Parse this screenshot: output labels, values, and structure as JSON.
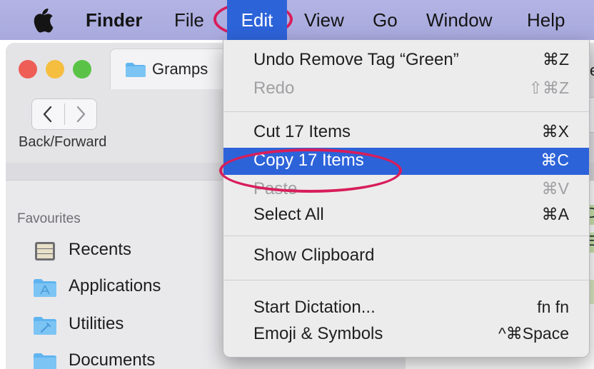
{
  "menubar": {
    "apple_icon": "apple-logo-icon",
    "items": [
      "Finder",
      "File",
      "Edit",
      "View",
      "Go",
      "Window",
      "Help"
    ],
    "active_item": "Edit",
    "background": "#abacdf",
    "highlight_color": "#2d63d9"
  },
  "finder_window": {
    "tab_title": "Gramps",
    "tab_partial": "er",
    "nav_label": "Back/Forward",
    "sidebar": {
      "heading": "Favourites",
      "items": [
        {
          "label": "Recents",
          "icon": "recents-icon"
        },
        {
          "label": "Applications",
          "icon": "applications-folder-icon"
        },
        {
          "label": "Utilities",
          "icon": "utilities-folder-icon"
        },
        {
          "label": "Documents",
          "icon": "documents-folder-icon"
        }
      ]
    },
    "partial_content_chars": [
      "D",
      "E"
    ]
  },
  "edit_menu": {
    "items": [
      {
        "label": "Undo Remove Tag “Green”",
        "shortcut": "⌘Z",
        "enabled": true
      },
      {
        "label": "Redo",
        "shortcut": "⇧⌘Z",
        "enabled": false
      },
      {
        "label": "Cut 17 Items",
        "shortcut": "⌘X",
        "enabled": true
      },
      {
        "label": "Copy 17 Items",
        "shortcut": "⌘C",
        "enabled": true,
        "highlighted": true
      },
      {
        "label": "Paste",
        "shortcut": "⌘V",
        "enabled": false
      },
      {
        "label": "Select All",
        "shortcut": "⌘A",
        "enabled": true
      },
      {
        "label": "Show Clipboard",
        "shortcut": "",
        "enabled": true
      },
      {
        "label": "Start Dictation...",
        "shortcut": "fn fn",
        "enabled": true
      },
      {
        "label": "Emoji & Symbols",
        "shortcut": "^⌘Space",
        "enabled": true
      }
    ]
  },
  "annotations": {
    "circle_color": "#d81d5a"
  }
}
